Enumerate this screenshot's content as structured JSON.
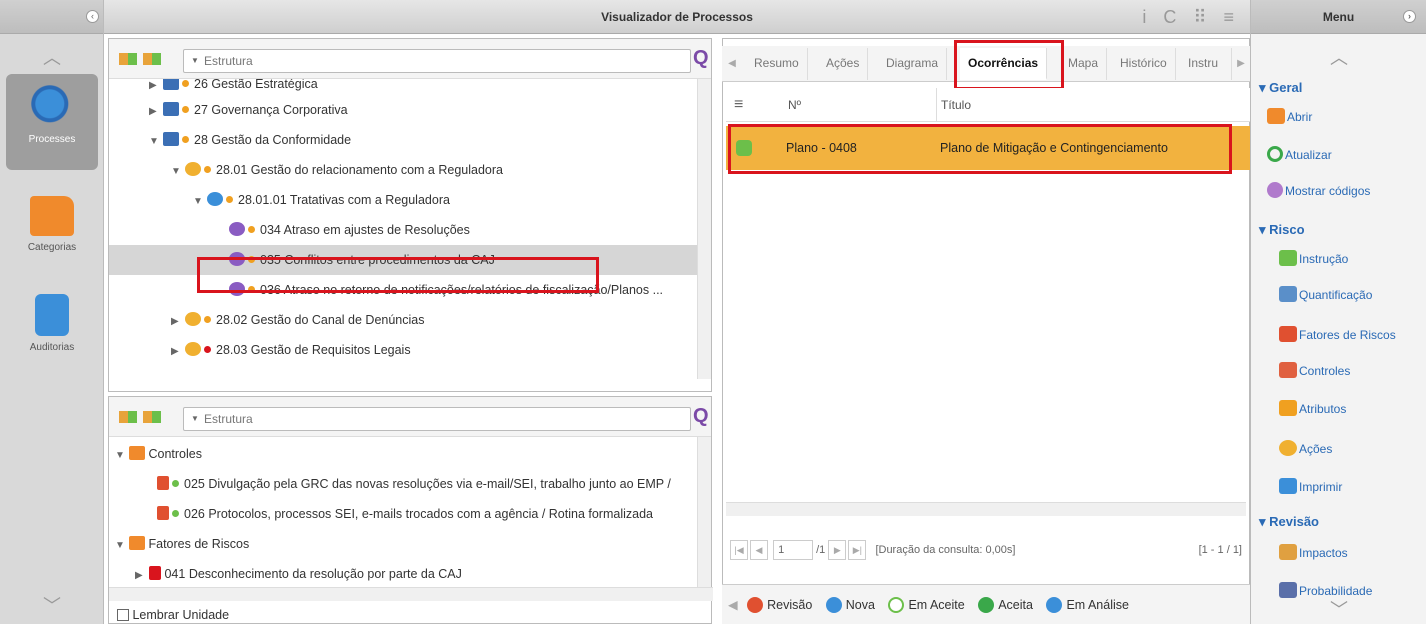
{
  "app": {
    "title": "Visualizador de Processos",
    "tools": "i C ⠿ ≡"
  },
  "leftnav": {
    "items": [
      {
        "label": "Processes",
        "icon": "gear-cluster-icon"
      },
      {
        "label": "Categorias",
        "icon": "folder-icon"
      },
      {
        "label": "Auditorias",
        "icon": "checklist-icon"
      }
    ]
  },
  "tree_top": {
    "search_placeholder": "Estrutura",
    "rows": [
      {
        "label": "26 Gestão Estratégica"
      },
      {
        "label": "27 Governança Corporativa"
      },
      {
        "label": "28 Gestão da Conformidade"
      },
      {
        "label": "28.01 Gestão do relacionamento com a Reguladora"
      },
      {
        "label": "28.01.01 Tratativas com a Reguladora"
      },
      {
        "label": "034 Atraso em ajustes de Resoluções"
      },
      {
        "label": "035 Conflitos entre procedimentos da CAJ"
      },
      {
        "label": "036 Atraso no retorno de notificações/relatórios de fiscalização/Planos ..."
      },
      {
        "label": "28.02 Gestão do Canal de Denúncias"
      },
      {
        "label": "28.03 Gestão de Requisitos Legais"
      }
    ]
  },
  "tree_bottom": {
    "search_placeholder": "Estrutura",
    "rows": [
      {
        "label": "Controles"
      },
      {
        "label": "025 Divulgação pela GRC das novas resoluções via e-mail/SEI, trabalho junto ao EMP /"
      },
      {
        "label": "026 Protocolos, processos SEI, e-mails trocados com a agência / Rotina formalizada"
      },
      {
        "label": "Fatores de Riscos"
      },
      {
        "label": "041 Desconhecimento da resolução por parte da CAJ"
      }
    ],
    "remember_label": "Lembrar Unidade"
  },
  "tabs": [
    "Resumo",
    "Ações",
    "Diagrama",
    "Ocorrências",
    "Mapa",
    "Histórico",
    "Instru"
  ],
  "active_tab": "Ocorrências",
  "grid": {
    "columns": [
      "Nº",
      "Título"
    ],
    "rows": [
      {
        "num": "Plano - 0408",
        "title": "Plano de Mitigação e Contingenciamento"
      }
    ]
  },
  "pager": {
    "page": "1",
    "of": "/1",
    "duration": "[Duração da consulta: 0,00s]",
    "range": "[1 - 1 / 1]"
  },
  "actions": [
    "Revisão",
    "Nova",
    "Em Aceite",
    "Aceita",
    "Em Análise"
  ],
  "menu": {
    "title": "Menu",
    "sections": [
      {
        "title": "Geral",
        "items": [
          "Abrir",
          "Atualizar",
          "Mostrar códigos"
        ]
      },
      {
        "title": "Risco",
        "items": [
          "Instrução",
          "Quantificação",
          "Fatores de Riscos",
          "Controles",
          "Atributos",
          "Ações",
          "Imprimir"
        ]
      },
      {
        "title": "Revisão",
        "items": [
          "Impactos",
          "Probabilidade"
        ]
      }
    ]
  }
}
